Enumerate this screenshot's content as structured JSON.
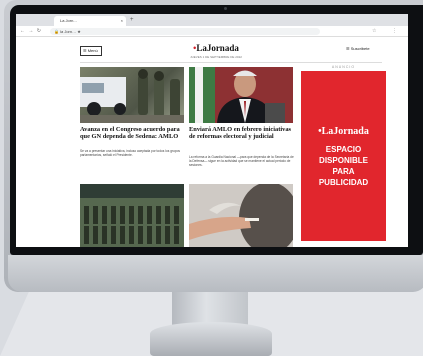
{
  "browser": {
    "tab_title": "La Jorn...",
    "tab_close": "×",
    "new_tab": "+",
    "nav_icons": "← → ↻",
    "url": "🔒 la Jorn…  ★",
    "ext_icons": [
      "☆",
      "⋮"
    ]
  },
  "site": {
    "menu_label": "☰ Menú",
    "logo_prefix": "•",
    "logo_text": "LaJornada",
    "date": "JUEVES 1 DE SEPTIEMBRE DE 2022",
    "subscribe_label": "☰ Suscribete"
  },
  "articles": [
    {
      "headline": "Avanza en el Congreso acuerdo para que GN dependa de Sedena: AMLO",
      "summary": "Se va a presentar una iniciativa, incluso aceptada por todos los grupos parlamentarios, señaló el Presidente."
    },
    {
      "headline": "Enviará AMLO en febrero iniciativas de reformas electoral y judicial",
      "summary": "La reforma a la Guardia Nacional —para que dependa de la Secretaría de la Defensa— sigue en la actividad que se mantiene el actual periodo de sesiones."
    }
  ],
  "ad": {
    "label": "ANUNCIO",
    "logo_prefix": "•",
    "logo": "LaJornada",
    "lines": [
      "ESPACIO",
      "DISPONIBLE",
      "PARA",
      "PUBLICIDAD"
    ]
  },
  "colors": {
    "brand_red": "#e1262d",
    "traffic_lights": [
      "#ff5f57",
      "#febc2e",
      "#28c840"
    ]
  }
}
